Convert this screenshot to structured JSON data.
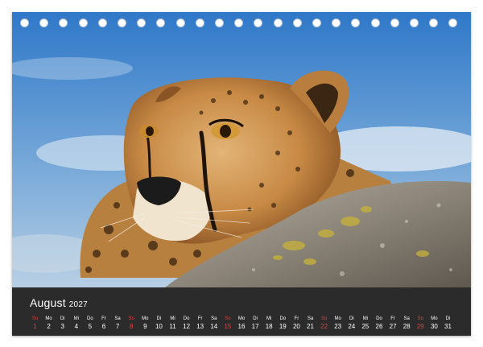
{
  "calendar": {
    "month": "August",
    "year": "2027",
    "days": [
      {
        "wd": "So",
        "d": "1",
        "sun": true
      },
      {
        "wd": "Mo",
        "d": "2",
        "sun": false
      },
      {
        "wd": "Di",
        "d": "3",
        "sun": false
      },
      {
        "wd": "Mi",
        "d": "4",
        "sun": false
      },
      {
        "wd": "Do",
        "d": "5",
        "sun": false
      },
      {
        "wd": "Fr",
        "d": "6",
        "sun": false
      },
      {
        "wd": "Sa",
        "d": "7",
        "sun": false
      },
      {
        "wd": "So",
        "d": "8",
        "sun": true
      },
      {
        "wd": "Mo",
        "d": "9",
        "sun": false
      },
      {
        "wd": "Di",
        "d": "10",
        "sun": false
      },
      {
        "wd": "Mi",
        "d": "11",
        "sun": false
      },
      {
        "wd": "Do",
        "d": "12",
        "sun": false
      },
      {
        "wd": "Fr",
        "d": "13",
        "sun": false
      },
      {
        "wd": "Sa",
        "d": "14",
        "sun": false
      },
      {
        "wd": "So",
        "d": "15",
        "sun": true
      },
      {
        "wd": "Mo",
        "d": "16",
        "sun": false
      },
      {
        "wd": "Di",
        "d": "17",
        "sun": false
      },
      {
        "wd": "Mi",
        "d": "18",
        "sun": false
      },
      {
        "wd": "Do",
        "d": "19",
        "sun": false
      },
      {
        "wd": "Fr",
        "d": "20",
        "sun": false
      },
      {
        "wd": "Sa",
        "d": "21",
        "sun": false
      },
      {
        "wd": "So",
        "d": "22",
        "sun": true
      },
      {
        "wd": "Mo",
        "d": "23",
        "sun": false
      },
      {
        "wd": "Di",
        "d": "24",
        "sun": false
      },
      {
        "wd": "Mi",
        "d": "25",
        "sun": false
      },
      {
        "wd": "Do",
        "d": "26",
        "sun": false
      },
      {
        "wd": "Fr",
        "d": "27",
        "sun": false
      },
      {
        "wd": "Sa",
        "d": "28",
        "sun": false
      },
      {
        "wd": "So",
        "d": "29",
        "sun": true
      },
      {
        "wd": "Mo",
        "d": "30",
        "sun": false
      },
      {
        "wd": "Di",
        "d": "31",
        "sun": false
      }
    ]
  },
  "binding": {
    "hole_count": 23
  },
  "colors": {
    "bar": "#2b2b2b",
    "text": "#ffffff",
    "sunday": "#e0403a",
    "sky": "#5b9bd5"
  }
}
